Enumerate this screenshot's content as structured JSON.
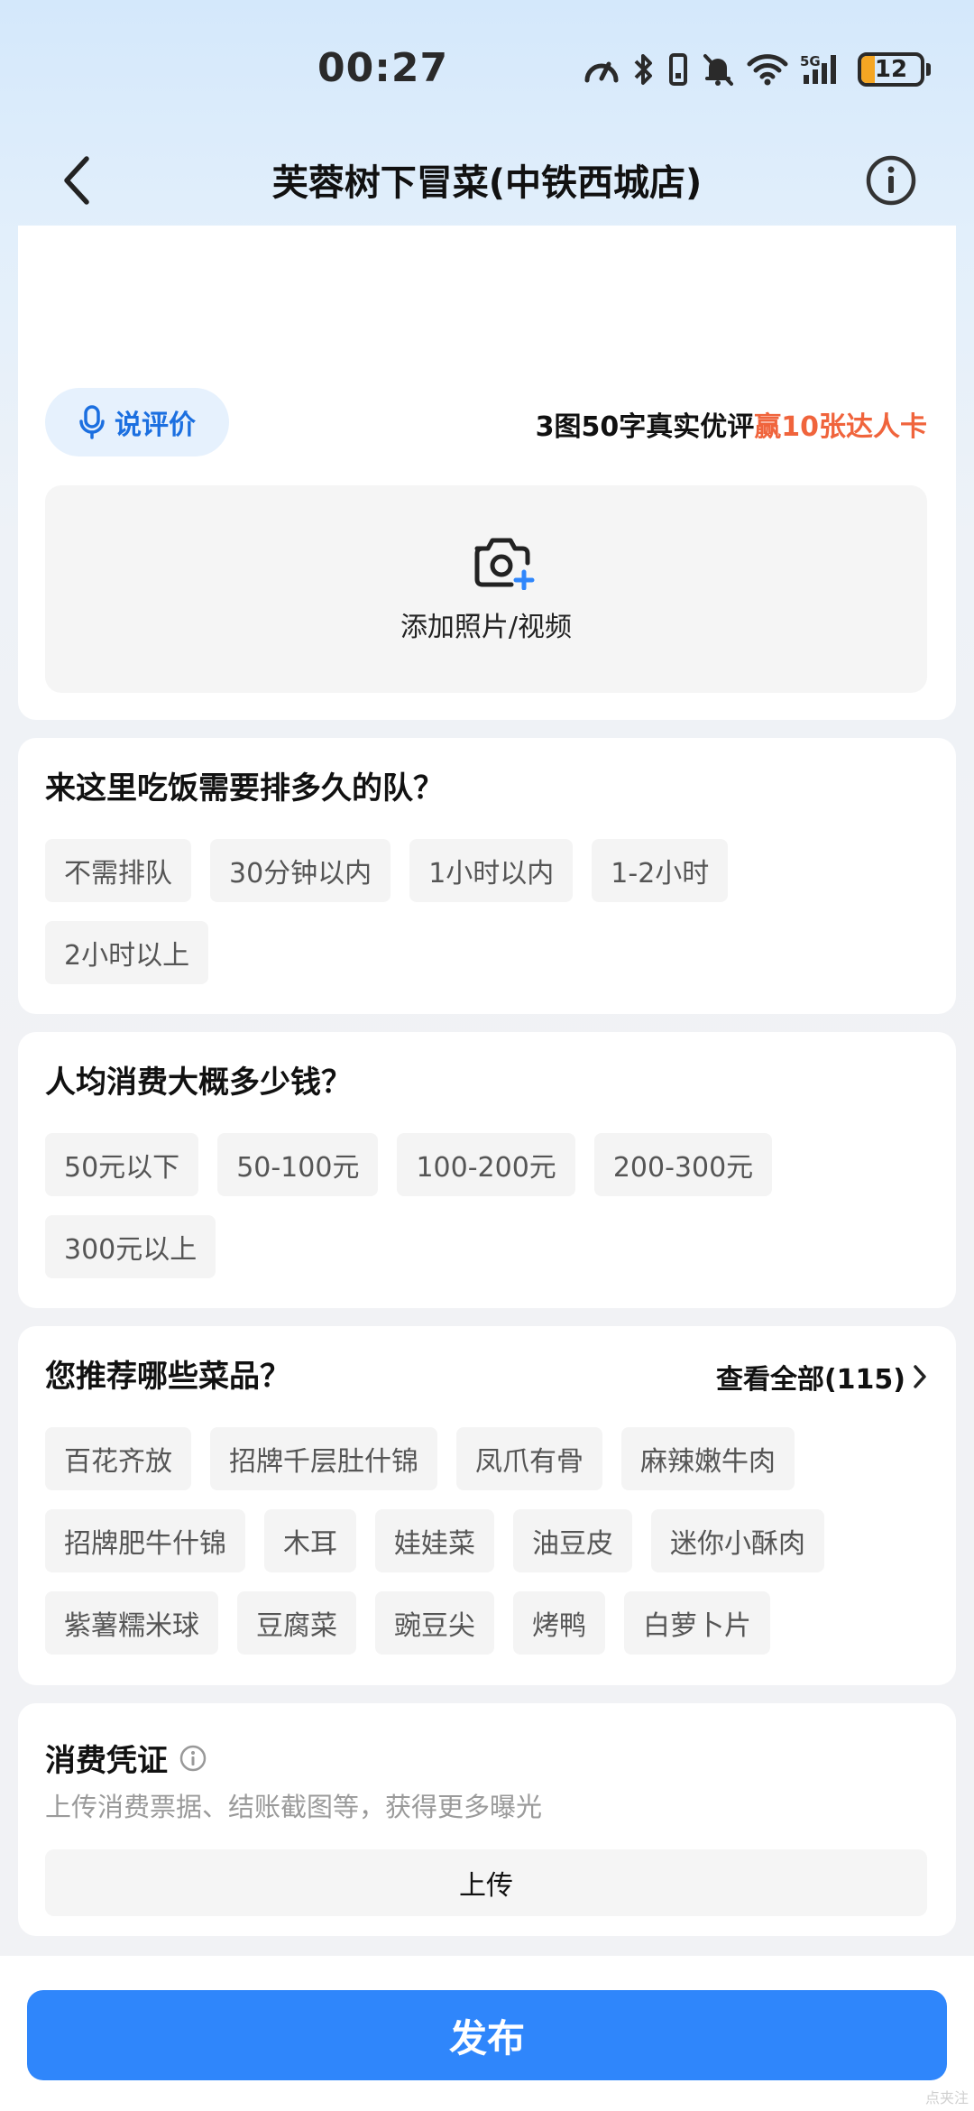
{
  "status_bar": {
    "time": "00:27",
    "battery": "12",
    "network": "5G"
  },
  "nav": {
    "title": "芙蓉树下冒菜(中铁西城店)"
  },
  "review": {
    "voice_label": "说评价",
    "promo_prefix": "3图50字真实优评",
    "promo_highlight": "赢10张达人卡",
    "add_media_label": "添加照片/视频"
  },
  "queue": {
    "title": "来这里吃饭需要排多久的队？",
    "options": [
      "不需排队",
      "30分钟以内",
      "1小时以内",
      "1-2小时",
      "2小时以上"
    ]
  },
  "price": {
    "title": "人均消费大概多少钱？",
    "options": [
      "50元以下",
      "50-100元",
      "100-200元",
      "200-300元",
      "300元以上"
    ]
  },
  "dishes": {
    "title": "您推荐哪些菜品？",
    "see_all": "查看全部(115)",
    "options": [
      "百花齐放",
      "招牌千层肚什锦",
      "凤爪有骨",
      "麻辣嫩牛肉",
      "招牌肥牛什锦",
      "木耳",
      "娃娃菜",
      "油豆皮",
      "迷你小酥肉",
      "紫薯糯米球",
      "豆腐菜",
      "豌豆尖",
      "烤鸭",
      "白萝卜片"
    ]
  },
  "voucher": {
    "title": "消费凭证",
    "description": "上传消费票据、结账截图等，获得更多曝光",
    "upload_label": "上传"
  },
  "publish": {
    "label": "发布"
  },
  "watermark": "点夹注",
  "colors": {
    "accent": "#2f86fb",
    "promo_highlight": "#f0643c",
    "voice_text": "#1b6fe0"
  }
}
